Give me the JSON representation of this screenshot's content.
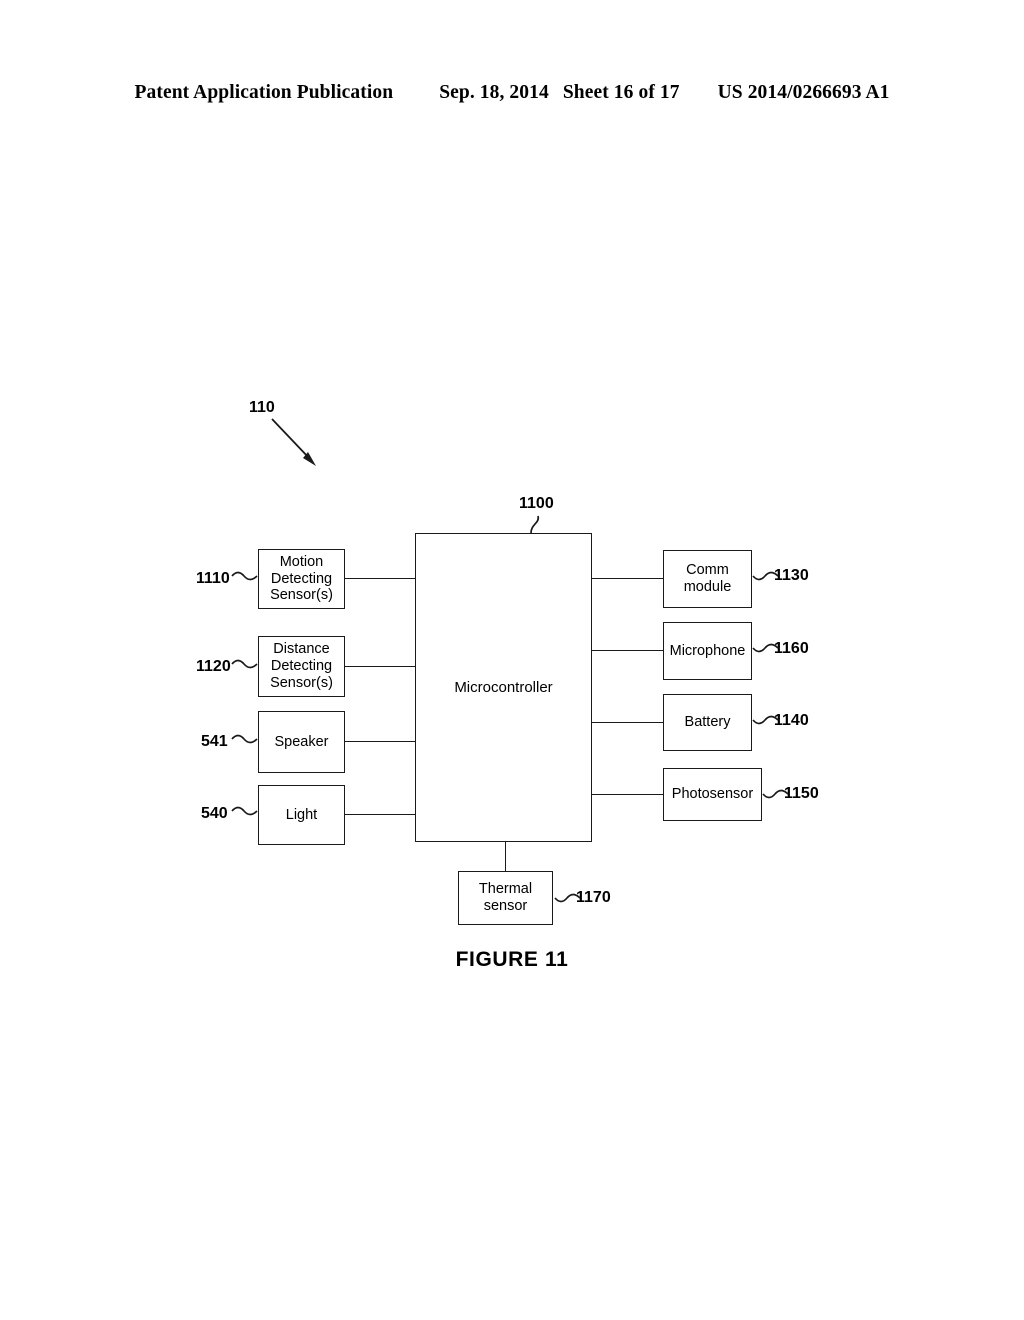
{
  "header": {
    "publication": "Patent Application Publication",
    "date": "Sep. 18, 2014",
    "sheet": "Sheet 16 of 17",
    "patent_number": "US 2014/0266693 A1"
  },
  "figure": {
    "caption": "FIGURE 11",
    "system_ref": "110",
    "controller": {
      "label": "Microcontroller",
      "ref": "1100"
    },
    "left_blocks": [
      {
        "label": "Motion Detecting Sensor(s)",
        "line1": "Motion",
        "line2": "Detecting",
        "line3": "Sensor(s)",
        "ref": "1110"
      },
      {
        "label": "Distance Detecting Sensor(s)",
        "line1": "Distance",
        "line2": "Detecting",
        "line3": "Sensor(s)",
        "ref": "1120"
      },
      {
        "label": "Speaker",
        "line1": "Speaker",
        "ref": "541"
      },
      {
        "label": "Light",
        "line1": "Light",
        "ref": "540"
      }
    ],
    "right_blocks": [
      {
        "label": "Comm module",
        "line1": "Comm",
        "line2": "module",
        "ref": "1130"
      },
      {
        "label": "Microphone",
        "line1": "Microphone",
        "ref": "1160"
      },
      {
        "label": "Battery",
        "line1": "Battery",
        "ref": "1140"
      },
      {
        "label": "Photosensor",
        "line1": "Photosensor",
        "ref": "1150"
      }
    ],
    "bottom_blocks": [
      {
        "label": "Thermal sensor",
        "line1": "Thermal",
        "line2": "sensor",
        "ref": "1170"
      }
    ]
  },
  "colors": {
    "ink": "#1a1a1a",
    "paper": "#ffffff"
  }
}
